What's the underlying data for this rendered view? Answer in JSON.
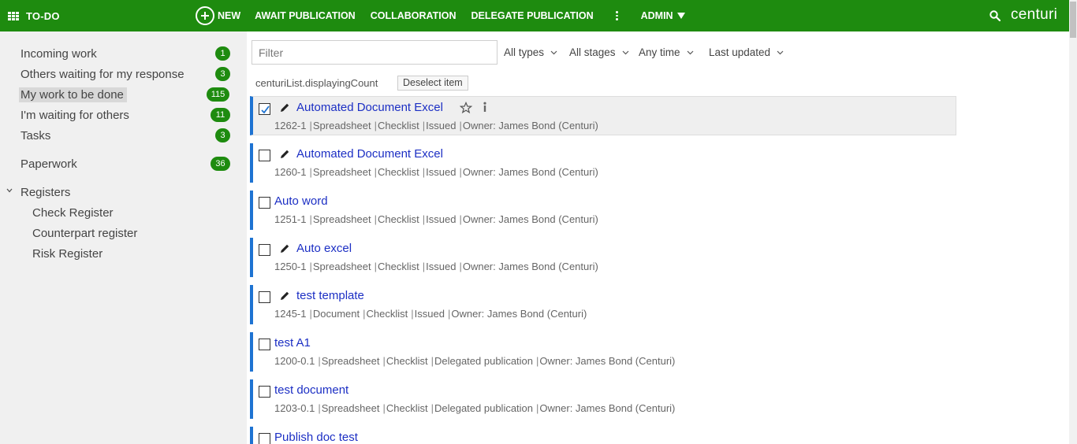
{
  "topbar": {
    "title": "TO-DO",
    "new_label": "NEW",
    "nav": [
      "AWAIT PUBLICATION",
      "COLLABORATION",
      "DELEGATE PUBLICATION"
    ],
    "admin_label": "ADMIN",
    "logo": "centuri"
  },
  "sidebar": {
    "items": [
      {
        "label": "Incoming work",
        "count": "1"
      },
      {
        "label": "Others waiting for my response",
        "count": "3"
      },
      {
        "label": "My work to be done",
        "count": "115"
      },
      {
        "label": "I'm waiting for others",
        "count": "11"
      },
      {
        "label": "Tasks",
        "count": "3"
      },
      {
        "label": "Paperwork",
        "count": "36"
      }
    ],
    "registers_label": "Registers",
    "registers": [
      "Check Register",
      "Counterpart register",
      "Risk Register"
    ]
  },
  "main": {
    "filter_placeholder": "Filter",
    "dropdowns": [
      "All types",
      "All stages",
      "Any time",
      "Last updated"
    ],
    "count_text": "centuriList.displayingCount",
    "deselect_label": "Deselect item",
    "items": [
      {
        "title": "Automated Document Excel",
        "meta": [
          "1262-1",
          "Spreadsheet",
          "Checklist",
          "Issued",
          "Owner: James Bond (Centuri)"
        ]
      },
      {
        "title": "Automated Document Excel",
        "meta": [
          "1260-1",
          "Spreadsheet",
          "Checklist",
          "Issued",
          "Owner: James Bond (Centuri)"
        ]
      },
      {
        "title": "Auto word",
        "meta": [
          "1251-1",
          "Spreadsheet",
          "Checklist",
          "Issued",
          "Owner: James Bond (Centuri)"
        ]
      },
      {
        "title": "Auto excel",
        "meta": [
          "1250-1",
          "Spreadsheet",
          "Checklist",
          "Issued",
          "Owner: James Bond (Centuri)"
        ]
      },
      {
        "title": "test template",
        "meta": [
          "1245-1",
          "Document",
          "Checklist",
          "Issued",
          "Owner: James Bond (Centuri)"
        ]
      },
      {
        "title": "test A1",
        "meta": [
          "1200-0.1",
          "Spreadsheet",
          "Checklist",
          "Delegated publication",
          "Owner: James Bond (Centuri)"
        ]
      },
      {
        "title": "test document",
        "meta": [
          "1203-0.1",
          "Spreadsheet",
          "Checklist",
          "Delegated publication",
          "Owner: James Bond (Centuri)"
        ]
      },
      {
        "title": "Publish doc test",
        "meta": []
      }
    ]
  },
  "colors": {
    "brand_green": "#1e8b0f",
    "accent_blue": "#1e73d2",
    "link_blue": "#1c2fc4"
  }
}
